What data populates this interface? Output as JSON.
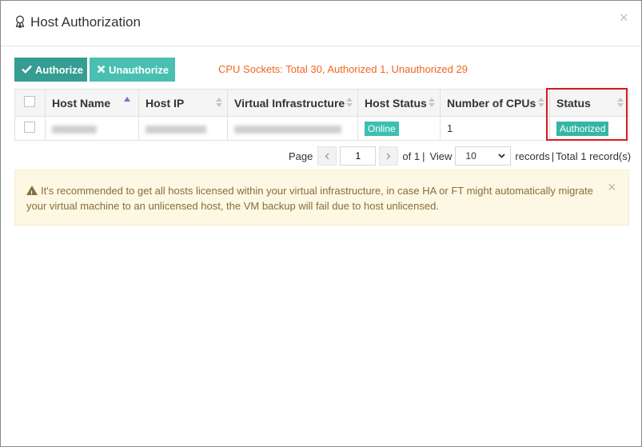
{
  "dialog": {
    "title": "Host Authorization",
    "close_glyph": "×"
  },
  "toolbar": {
    "authorize_label": "Authorize",
    "unauthorize_label": "Unauthorize",
    "cpu_info": "CPU Sockets: Total 30, Authorized 1, Unauthorized 29"
  },
  "table": {
    "columns": [
      "Host Name",
      "Host IP",
      "Virtual Infrastructure",
      "Host Status",
      "Number of CPUs",
      "Status"
    ],
    "rows": [
      {
        "host_status": "Online",
        "cpus": "1",
        "status": "Authorized"
      }
    ]
  },
  "pager": {
    "page_label": "Page",
    "current_page": "1",
    "of_label": "of 1",
    "view_label": "View",
    "page_size": "10",
    "records_label": "records",
    "total_label": "Total 1 record(s)"
  },
  "alert": {
    "message": "It's recommended to get all hosts licensed within your virtual infrastructure, in case HA or FT might automatically migrate your virtual machine to an unlicensed host, the VM backup will fail due to host unlicensed.",
    "close_glyph": "×"
  },
  "colors": {
    "authorize_button": "#359d91",
    "unauthorize_button": "#49bfb2",
    "cpu_info_text": "#f26522",
    "online_badge": "#3cc0af",
    "authorized_badge": "#35b6a4",
    "highlight_border": "#d9181f",
    "alert_background": "#fcf8e3"
  },
  "icons": {
    "title": "award-ribbon-icon",
    "authorize": "check-icon",
    "unauthorize": "x-icon",
    "alert": "warning-triangle-icon"
  }
}
